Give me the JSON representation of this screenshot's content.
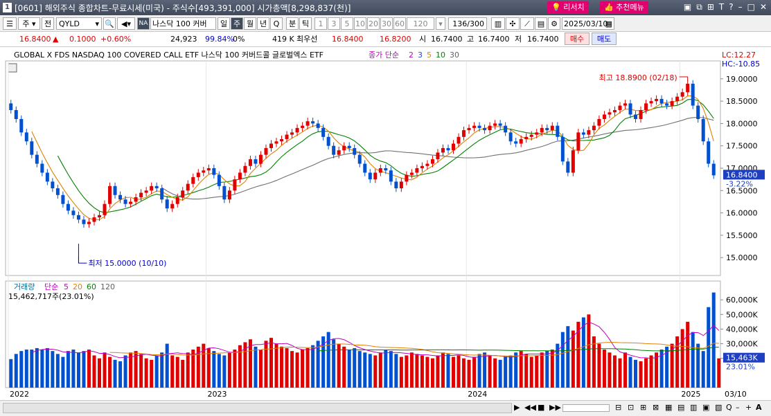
{
  "window": {
    "num": "1",
    "title": "[0601] 해외주식 종합차트-무료시세(미국) - 주식수[493,391,000] 시가총액[8,298,837(천)]",
    "btn_research": "리서치",
    "btn_recommend": "추천메뉴"
  },
  "toolbar": {
    "mode": "주",
    "prev": "전",
    "ticker": "QYLD",
    "badge": "NA",
    "name": "나스닥 100 커버",
    "periods": [
      "일",
      "주",
      "월",
      "년",
      "Q"
    ],
    "active_period": "주",
    "minute": "분",
    "tick": "틱",
    "intervals": [
      "1",
      "3",
      "5",
      "10",
      "20",
      "30",
      "60",
      "120"
    ],
    "count": "136",
    "count_total": "/300",
    "date": "2025/03/10"
  },
  "quote": {
    "price": "16.8400",
    "arrow": "▲",
    "change": "0.1000",
    "pct": "+0.60%",
    "volume": "24,923",
    "vol_pct": "99.84%",
    "zero": "0%",
    "k": "419 K",
    "bid_label": "최우선",
    "bid": "16.8400",
    "ask": "16.8200",
    "open_label": "시",
    "open": "16.7400",
    "high_label": "고",
    "high": "16.7400",
    "low_label": "저",
    "low": "16.7400",
    "buy": "매수",
    "sell": "매도"
  },
  "price_panel": {
    "series_name": "GLOBAL X FDS NASDAQ 100 COVERED CALL ETF  나스닥 100 커버드콜 글로벌엑스 ETF",
    "ma_label": "종가 단순",
    "ma_periods": [
      "2",
      "3",
      "5",
      "10",
      "30"
    ],
    "ma_colors": [
      "#c000c0",
      "#3040c0",
      "#e08000",
      "#008000",
      "#606060"
    ],
    "lc": "LC:12.27",
    "hc": "HC:-10.85",
    "high_note": "최고 18.8900 (02/18)",
    "low_note": "최저 15.0000 (10/10)",
    "last_price": "16.8400",
    "last_pct": "-3.22%",
    "y_ticks": [
      "19.0000",
      "18.5000",
      "18.0000",
      "17.5000",
      "17.0000",
      "16.5000",
      "16.0000",
      "15.5000",
      "15.0000"
    ]
  },
  "volume_panel": {
    "label": "거래량",
    "ma_label": "단순",
    "ma_periods": [
      "5",
      "20",
      "60",
      "120"
    ],
    "ma_colors": [
      "#c000c0",
      "#e08000",
      "#008000",
      "#606060"
    ],
    "info": "15,462,717주(23.01%)",
    "y_ticks": [
      "60,000K",
      "50,000K",
      "40,000K",
      "30,000K",
      "20,000K"
    ],
    "last": "15,463K",
    "last_pct": "23.01%"
  },
  "x_axis": {
    "labels": [
      "2022",
      "2023",
      "2024",
      "2025"
    ],
    "end_label": "03/10"
  },
  "colors": {
    "up": "#e00000",
    "down": "#0050d0",
    "accent": "#3f4a5c",
    "brand": "#e0006e"
  },
  "chart_data": {
    "type": "candlestick",
    "x_axis_years": [
      "2022",
      "2023",
      "2024",
      "2025"
    ],
    "ylim": [
      14.6,
      19.4
    ],
    "high": {
      "value": 18.89,
      "date": "02/18"
    },
    "low": {
      "value": 15.0,
      "date": "10/10"
    },
    "last_close": 16.84,
    "closes": [
      18.3,
      18.1,
      17.8,
      17.6,
      17.3,
      17.1,
      16.9,
      16.7,
      16.55,
      16.4,
      16.2,
      16.05,
      15.95,
      15.85,
      15.75,
      15.8,
      15.9,
      15.95,
      16.2,
      16.6,
      16.4,
      16.3,
      16.2,
      16.25,
      16.35,
      16.45,
      16.5,
      16.6,
      16.55,
      16.3,
      16.1,
      16.2,
      16.35,
      16.5,
      16.65,
      16.8,
      16.9,
      16.95,
      17.0,
      16.85,
      16.6,
      16.3,
      16.5,
      16.75,
      16.9,
      17.05,
      17.2,
      17.1,
      17.3,
      17.45,
      17.55,
      17.6,
      17.65,
      17.75,
      17.8,
      17.9,
      17.95,
      18.05,
      18.0,
      17.9,
      17.7,
      17.5,
      17.3,
      17.4,
      17.5,
      17.45,
      17.3,
      17.1,
      16.9,
      16.75,
      16.9,
      17.0,
      16.95,
      16.7,
      16.55,
      16.7,
      16.85,
      16.9,
      17.0,
      17.05,
      17.1,
      17.2,
      17.35,
      17.45,
      17.4,
      17.55,
      17.7,
      17.85,
      17.9,
      17.95,
      17.9,
      17.85,
      17.95,
      18.0,
      17.95,
      17.8,
      17.6,
      17.55,
      17.65,
      17.7,
      17.75,
      17.8,
      17.9,
      17.85,
      17.95,
      17.7,
      17.15,
      16.9,
      17.4,
      17.8,
      17.75,
      17.85,
      17.95,
      18.1,
      18.2,
      18.25,
      18.3,
      18.4,
      18.45,
      18.2,
      18.1,
      18.3,
      18.45,
      18.5,
      18.55,
      18.45,
      18.4,
      18.5,
      18.6,
      18.7,
      18.89,
      18.4,
      18.1,
      17.6,
      17.1,
      16.84
    ]
  },
  "volume_data": {
    "values": [
      19.5,
      23,
      25,
      26,
      26,
      27,
      26,
      27,
      25,
      23,
      21,
      25,
      26,
      24,
      25,
      26,
      22,
      20,
      24,
      21,
      19,
      18,
      22,
      24,
      25,
      23,
      20,
      19,
      22,
      24,
      30,
      22,
      21,
      19,
      24,
      26,
      28,
      30,
      27,
      25,
      23,
      22,
      24,
      26,
      29,
      31,
      33,
      28,
      26,
      32,
      34,
      30,
      28,
      27,
      25,
      24,
      26,
      27,
      29,
      32,
      35,
      38,
      33,
      30,
      28,
      26,
      27,
      25,
      24,
      23,
      22,
      24,
      26,
      25,
      23,
      21,
      22,
      24,
      23,
      22,
      21,
      20,
      22,
      24,
      23,
      21,
      22,
      20,
      19,
      21,
      23,
      24,
      22,
      20,
      19,
      21,
      22,
      24,
      25,
      23,
      21,
      22,
      24,
      25,
      26,
      30,
      38,
      42,
      39,
      45,
      48,
      50,
      35,
      30,
      26,
      24,
      22,
      20,
      24,
      21,
      19,
      18,
      20,
      22,
      24,
      26,
      28,
      30,
      35,
      40,
      45,
      38,
      30,
      25,
      55,
      65,
      20
    ]
  }
}
